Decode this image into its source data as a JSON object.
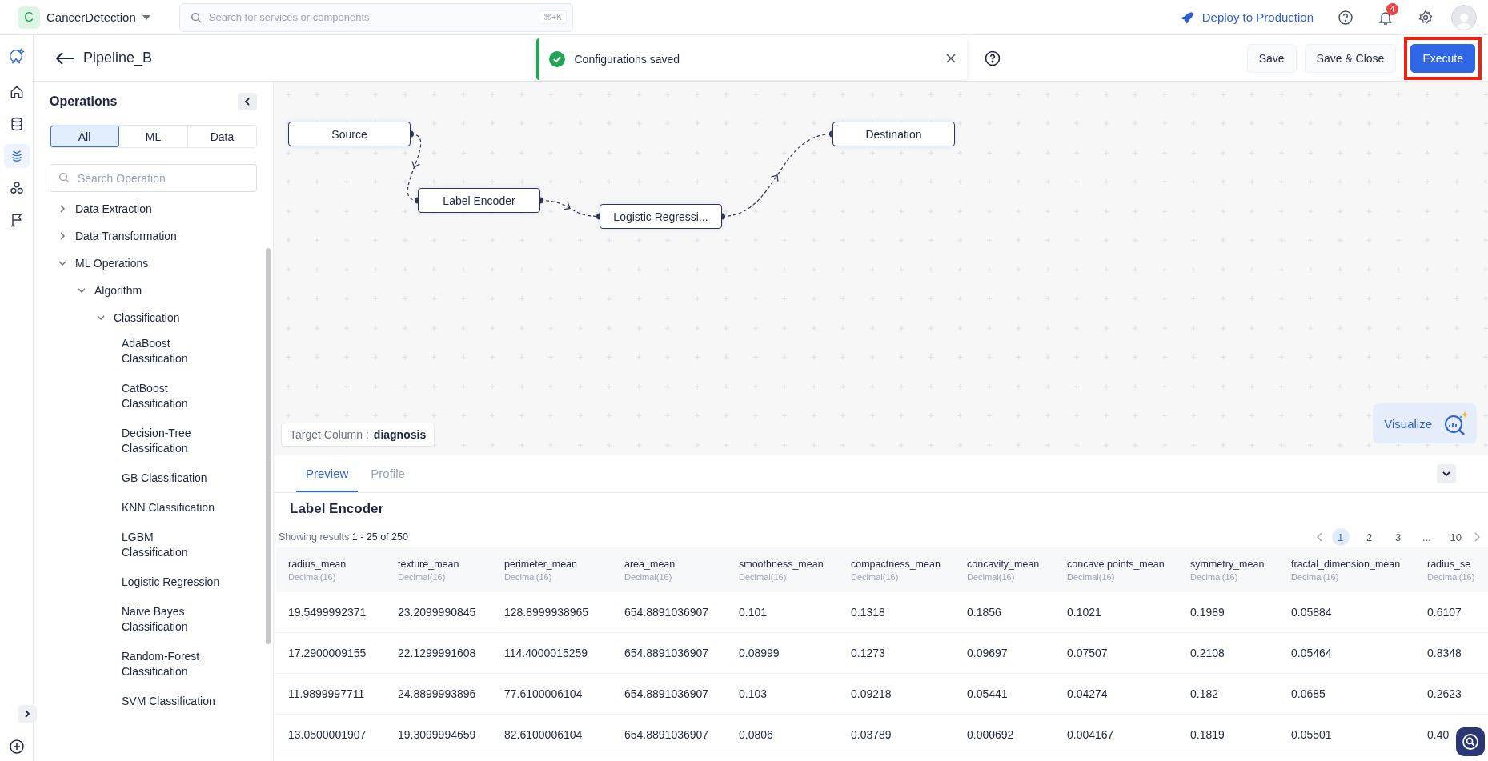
{
  "app": {
    "badge": "C",
    "name": "CancerDetection"
  },
  "global_search": {
    "placeholder": "Search for services or components",
    "shortcut": "⌘+K"
  },
  "top_actions": {
    "deploy": "Deploy to Production",
    "notification_count": "4"
  },
  "rail": [
    {
      "kind": "home",
      "selected": false
    },
    {
      "kind": "database",
      "selected": false
    },
    {
      "kind": "pipeline",
      "selected": true
    },
    {
      "kind": "cluster",
      "selected": false
    },
    {
      "kind": "flag",
      "selected": false
    }
  ],
  "header": {
    "title": "Pipeline_B",
    "toast": {
      "message": "Configurations saved"
    },
    "buttons": [
      {
        "label": "Save",
        "kind": "secondary",
        "highlighted": false
      },
      {
        "label": "Save & Close",
        "kind": "secondary",
        "highlighted": false
      },
      {
        "label": "Execute",
        "kind": "primary",
        "highlighted": true
      }
    ]
  },
  "sidebar": {
    "title": "Operations",
    "filters": [
      {
        "label": "All",
        "selected": true
      },
      {
        "label": "ML",
        "selected": false
      },
      {
        "label": "Data",
        "selected": false
      }
    ],
    "search": {
      "placeholder": "Search Operation"
    },
    "tree": [
      {
        "label": "Data Extraction",
        "expanded": false
      },
      {
        "label": "Data Transformation",
        "expanded": false
      },
      {
        "label": "ML Operations",
        "expanded": true,
        "children": [
          {
            "label": "Algorithm",
            "expanded": true,
            "children": [
              {
                "label": "Classification",
                "expanded": true,
                "children": [
                  {
                    "label": "AdaBoost Classification"
                  },
                  {
                    "label": "CatBoost Classification"
                  },
                  {
                    "label": "Decision-Tree Classification"
                  },
                  {
                    "label": "GB Classification"
                  },
                  {
                    "label": "KNN Classification"
                  },
                  {
                    "label": "LGBM Classification"
                  },
                  {
                    "label": "Logistic Regression"
                  },
                  {
                    "label": "Naive Bayes Classification"
                  },
                  {
                    "label": "Random-Forest Classification"
                  },
                  {
                    "label": "SVM Classification"
                  }
                ]
              }
            ]
          }
        ]
      }
    ]
  },
  "canvas": {
    "nodes": [
      {
        "label": "Source"
      },
      {
        "label": "Label Encoder"
      },
      {
        "label": "Logistic Regressi..."
      },
      {
        "label": "Destination"
      }
    ],
    "target_column": {
      "label": "Target Column :",
      "value": "diagnosis"
    },
    "visualize": "Visualize"
  },
  "preview": {
    "tabs": [
      {
        "label": "Preview",
        "selected": true
      },
      {
        "label": "Profile",
        "selected": false
      }
    ],
    "title": "Label Encoder",
    "summary": "Showing results **1 - 25 of 250**",
    "pagination": [
      {
        "label": "1",
        "selected": true
      },
      {
        "label": "2",
        "selected": false
      },
      {
        "label": "3",
        "selected": false
      },
      {
        "label": "...",
        "selected": false
      },
      {
        "label": "10",
        "selected": false
      }
    ],
    "table": {
      "columns": [
        {
          "name": "radius_mean",
          "type": "Decimal(16)"
        },
        {
          "name": "texture_mean",
          "type": "Decimal(16)"
        },
        {
          "name": "perimeter_mean",
          "type": "Decimal(16)"
        },
        {
          "name": "area_mean",
          "type": "Decimal(16)"
        },
        {
          "name": "smoothness_mean",
          "type": "Decimal(16)"
        },
        {
          "name": "compactness_mean",
          "type": "Decimal(16)"
        },
        {
          "name": "concavity_mean",
          "type": "Decimal(16)"
        },
        {
          "name": "concave points_mean",
          "type": "Decimal(16)"
        },
        {
          "name": "symmetry_mean",
          "type": "Decimal(16)"
        },
        {
          "name": "fractal_dimension_mean",
          "type": "Decimal(16)"
        },
        {
          "name": "radius_se",
          "type": "Decimal(16)"
        }
      ],
      "rows": [
        [
          "19.5499992371",
          "23.2099990845",
          "128.8999938965",
          "654.8891036907",
          "0.101",
          "0.1318",
          "0.1856",
          "0.1021",
          "0.1989",
          "0.05884",
          "0.6107"
        ],
        [
          "17.2900009155",
          "22.1299991608",
          "114.4000015259",
          "654.8891036907",
          "0.08999",
          "0.1273",
          "0.09697",
          "0.07507",
          "0.2108",
          "0.05464",
          "0.8348"
        ],
        [
          "11.9899997711",
          "24.8899993896",
          "77.6100006104",
          "654.8891036907",
          "0.103",
          "0.09218",
          "0.05441",
          "0.04274",
          "0.182",
          "0.0685",
          "0.2623"
        ],
        [
          "13.0500001907",
          "19.3099994659",
          "82.6100006104",
          "654.8891036907",
          "0.0806",
          "0.03789",
          "0.000692",
          "0.004167",
          "0.1819",
          "0.05501",
          "0.40"
        ]
      ]
    }
  }
}
